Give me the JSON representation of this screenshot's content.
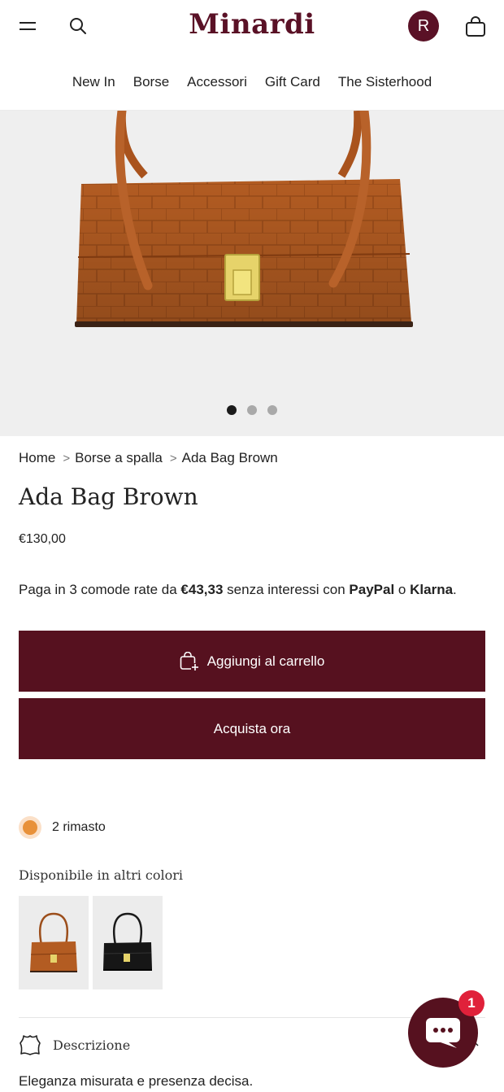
{
  "header": {
    "logo": "Minardi",
    "avatar_initial": "R",
    "icons": {
      "menu": "menu-icon",
      "search": "search-icon",
      "cart": "bag-icon"
    },
    "brand_color": "#5a1126"
  },
  "nav": {
    "items": [
      {
        "label": "New In"
      },
      {
        "label": "Borse"
      },
      {
        "label": "Accessori"
      },
      {
        "label": "Gift Card"
      },
      {
        "label": "The Sisterhood"
      }
    ]
  },
  "gallery": {
    "slide_count": 3,
    "active_slide": 1,
    "image": "brown croc-embossed shoulder bag with gold clasp"
  },
  "breadcrumb": {
    "items": [
      {
        "label": "Home"
      },
      {
        "label": "Borse a spalla"
      },
      {
        "label": "Ada Bag Brown"
      }
    ],
    "separator": ">"
  },
  "product": {
    "title": "Ada Bag Brown",
    "price": "€130,00"
  },
  "installments": {
    "prefix": "Paga in 3 comode rate da",
    "amount": "€43,33",
    "middle": "senza interessi con",
    "provider_1": "PayPal",
    "connector": "o",
    "provider_2": "Klarna",
    "end": "."
  },
  "actions": {
    "add_to_cart": "Aggiungi al carrello",
    "buy_now": "Acquista ora",
    "button_color": "#56111f"
  },
  "stock": {
    "text": "2 rimasto",
    "indicator_color": "#e8913a"
  },
  "colors": {
    "label": "Disponibile in altri colori",
    "options": [
      {
        "name": "Brown",
        "color": "#b05a23"
      },
      {
        "name": "Black",
        "color": "#1a1a1a"
      }
    ]
  },
  "description": {
    "label": "Descrizione",
    "text": "Eleganza misurata e presenza decisa."
  },
  "chat": {
    "badge_count": "1"
  }
}
